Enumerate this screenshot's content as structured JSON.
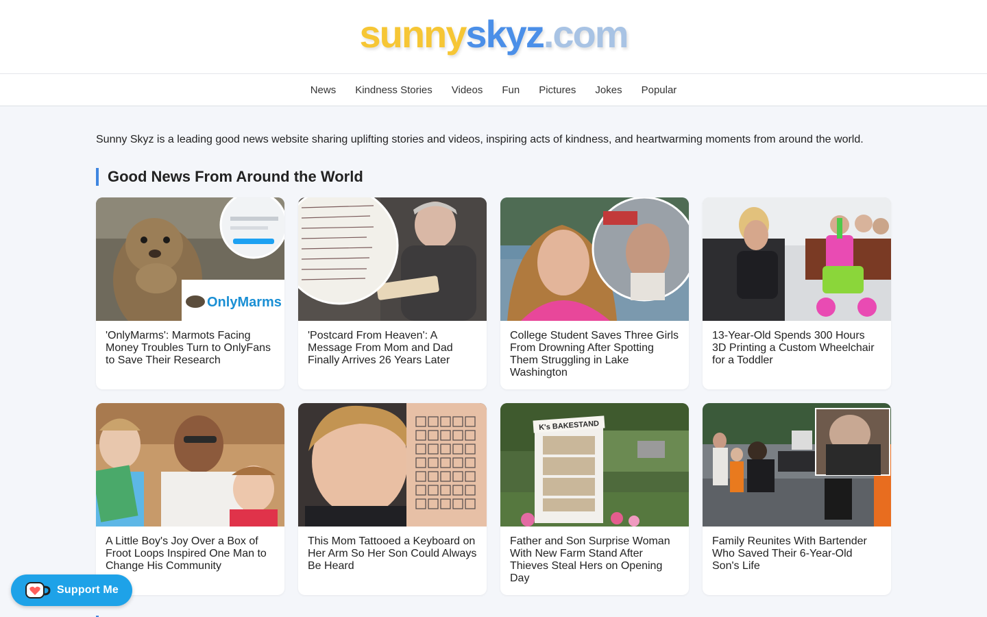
{
  "header": {
    "logo_part1": "sunny",
    "logo_part2": "skyz",
    "logo_part3": ".com"
  },
  "nav": {
    "items": [
      "News",
      "Kindness Stories",
      "Videos",
      "Fun",
      "Pictures",
      "Jokes",
      "Popular"
    ]
  },
  "intro": "Sunny Skyz is a leading good news website sharing uplifting stories and videos, inspiring acts of kindness, and heartwarming moments from around the world.",
  "section": {
    "title": "Good News From Around the World"
  },
  "articles": [
    {
      "title": "'OnlyMarms': Marmots Facing Money Troubles Turn to OnlyFans to Save Their Research",
      "thumb_caption": "OnlyMarms"
    },
    {
      "title": "'Postcard From Heaven': A Message From Mom and Dad Finally Arrives 26 Years Later"
    },
    {
      "title": "College Student Saves Three Girls From Drowning After Spotting Them Struggling in Lake Washington"
    },
    {
      "title": "13-Year-Old Spends 300 Hours 3D Printing a Custom Wheelchair for a Toddler"
    },
    {
      "title": "A Little Boy's Joy Over a Box of Froot Loops Inspired One Man to Change His Community"
    },
    {
      "title": "This Mom Tattooed a Keyboard on Her Arm So Her Son Could Always Be Heard"
    },
    {
      "title": "Father and Son Surprise Woman With New Farm Stand After Thieves Steal Hers on Opening Day",
      "thumb_caption": "K's BAKESTAND"
    },
    {
      "title": "Family Reunites With Bartender Who Saved Their 6-Year-Old Son's Life"
    }
  ],
  "support": {
    "label": "Support Me",
    "icon": "kofi-cup-icon"
  },
  "colors": {
    "accent": "#3f86e0",
    "logo_yellow": "#f6c635",
    "logo_blue": "#4b8fe8",
    "support_bg": "#1ea2e8"
  }
}
